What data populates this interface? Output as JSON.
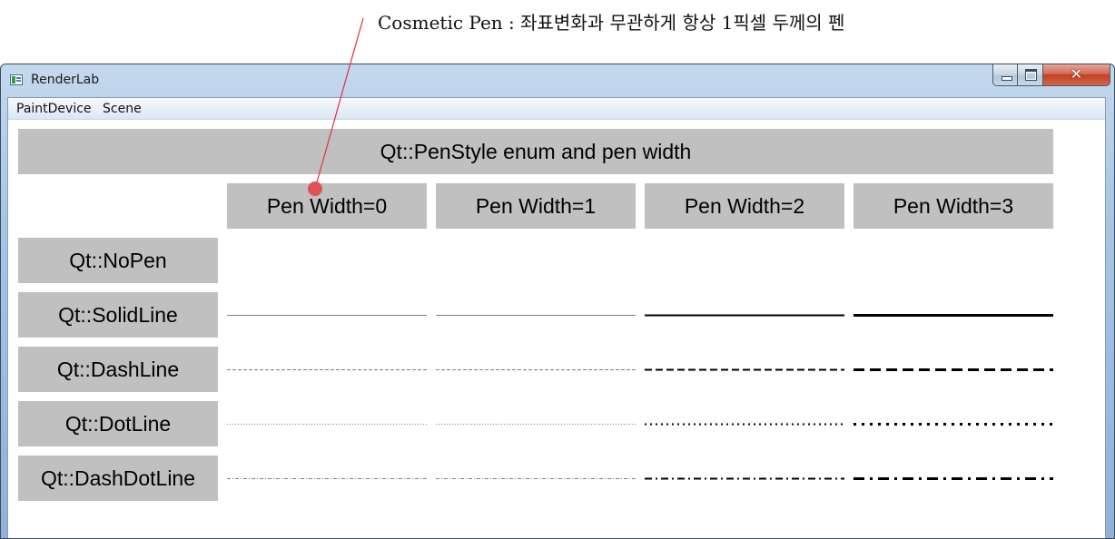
{
  "annotation": {
    "text": "Cosmetic Pen : 좌표변화과 무관하게 항상 1픽셀 두께의 펜"
  },
  "window": {
    "title": "RenderLab",
    "icons": {
      "app": "app-window-icon",
      "minimize": "minimize-icon",
      "maximize": "maximize-icon",
      "close": "close-icon"
    },
    "close_glyph": "✕"
  },
  "menubar": {
    "items": [
      "PaintDevice",
      "Scene"
    ]
  },
  "table": {
    "header": "Qt::PenStyle enum and pen width",
    "columns": [
      "Pen Width=0",
      "Pen Width=1",
      "Pen Width=2",
      "Pen Width=3"
    ],
    "pen_widths": [
      0,
      1,
      2,
      3
    ],
    "rows": [
      {
        "label": "Qt::NoPen",
        "style": "NoPen"
      },
      {
        "label": "Qt::SolidLine",
        "style": "SolidLine"
      },
      {
        "label": "Qt::DashLine",
        "style": "DashLine"
      },
      {
        "label": "Qt::DotLine",
        "style": "DotLine"
      },
      {
        "label": "Qt::DashDotLine",
        "style": "DashDotLine"
      }
    ]
  },
  "colors": {
    "cell_background": "#c0c0c0",
    "thin_pen": "#808080",
    "thick_pen": "#000000",
    "callout": "#e0303a",
    "callout_dot": "#e05058"
  }
}
